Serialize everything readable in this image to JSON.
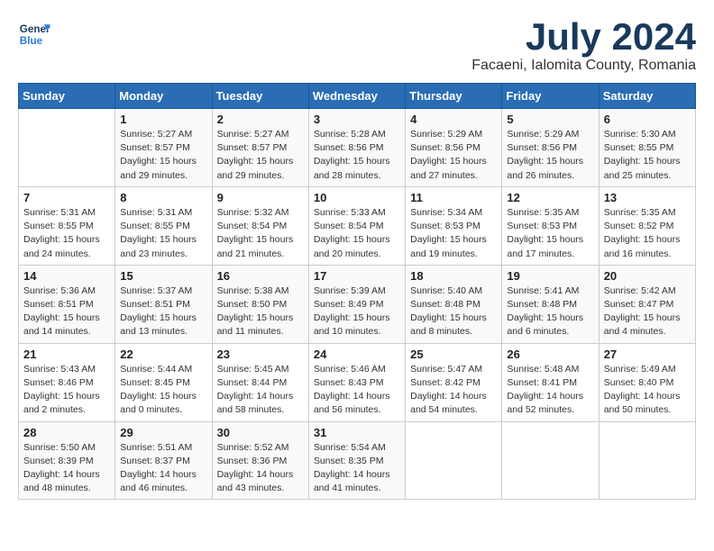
{
  "logo": {
    "line1": "General",
    "line2": "Blue"
  },
  "title": "July 2024",
  "subtitle": "Facaeni, Ialomita County, Romania",
  "days_header": [
    "Sunday",
    "Monday",
    "Tuesday",
    "Wednesday",
    "Thursday",
    "Friday",
    "Saturday"
  ],
  "weeks": [
    [
      {
        "num": "",
        "info": ""
      },
      {
        "num": "1",
        "info": "Sunrise: 5:27 AM\nSunset: 8:57 PM\nDaylight: 15 hours\nand 29 minutes."
      },
      {
        "num": "2",
        "info": "Sunrise: 5:27 AM\nSunset: 8:57 PM\nDaylight: 15 hours\nand 29 minutes."
      },
      {
        "num": "3",
        "info": "Sunrise: 5:28 AM\nSunset: 8:56 PM\nDaylight: 15 hours\nand 28 minutes."
      },
      {
        "num": "4",
        "info": "Sunrise: 5:29 AM\nSunset: 8:56 PM\nDaylight: 15 hours\nand 27 minutes."
      },
      {
        "num": "5",
        "info": "Sunrise: 5:29 AM\nSunset: 8:56 PM\nDaylight: 15 hours\nand 26 minutes."
      },
      {
        "num": "6",
        "info": "Sunrise: 5:30 AM\nSunset: 8:55 PM\nDaylight: 15 hours\nand 25 minutes."
      }
    ],
    [
      {
        "num": "7",
        "info": "Sunrise: 5:31 AM\nSunset: 8:55 PM\nDaylight: 15 hours\nand 24 minutes."
      },
      {
        "num": "8",
        "info": "Sunrise: 5:31 AM\nSunset: 8:55 PM\nDaylight: 15 hours\nand 23 minutes."
      },
      {
        "num": "9",
        "info": "Sunrise: 5:32 AM\nSunset: 8:54 PM\nDaylight: 15 hours\nand 21 minutes."
      },
      {
        "num": "10",
        "info": "Sunrise: 5:33 AM\nSunset: 8:54 PM\nDaylight: 15 hours\nand 20 minutes."
      },
      {
        "num": "11",
        "info": "Sunrise: 5:34 AM\nSunset: 8:53 PM\nDaylight: 15 hours\nand 19 minutes."
      },
      {
        "num": "12",
        "info": "Sunrise: 5:35 AM\nSunset: 8:53 PM\nDaylight: 15 hours\nand 17 minutes."
      },
      {
        "num": "13",
        "info": "Sunrise: 5:35 AM\nSunset: 8:52 PM\nDaylight: 15 hours\nand 16 minutes."
      }
    ],
    [
      {
        "num": "14",
        "info": "Sunrise: 5:36 AM\nSunset: 8:51 PM\nDaylight: 15 hours\nand 14 minutes."
      },
      {
        "num": "15",
        "info": "Sunrise: 5:37 AM\nSunset: 8:51 PM\nDaylight: 15 hours\nand 13 minutes."
      },
      {
        "num": "16",
        "info": "Sunrise: 5:38 AM\nSunset: 8:50 PM\nDaylight: 15 hours\nand 11 minutes."
      },
      {
        "num": "17",
        "info": "Sunrise: 5:39 AM\nSunset: 8:49 PM\nDaylight: 15 hours\nand 10 minutes."
      },
      {
        "num": "18",
        "info": "Sunrise: 5:40 AM\nSunset: 8:48 PM\nDaylight: 15 hours\nand 8 minutes."
      },
      {
        "num": "19",
        "info": "Sunrise: 5:41 AM\nSunset: 8:48 PM\nDaylight: 15 hours\nand 6 minutes."
      },
      {
        "num": "20",
        "info": "Sunrise: 5:42 AM\nSunset: 8:47 PM\nDaylight: 15 hours\nand 4 minutes."
      }
    ],
    [
      {
        "num": "21",
        "info": "Sunrise: 5:43 AM\nSunset: 8:46 PM\nDaylight: 15 hours\nand 2 minutes."
      },
      {
        "num": "22",
        "info": "Sunrise: 5:44 AM\nSunset: 8:45 PM\nDaylight: 15 hours\nand 0 minutes."
      },
      {
        "num": "23",
        "info": "Sunrise: 5:45 AM\nSunset: 8:44 PM\nDaylight: 14 hours\nand 58 minutes."
      },
      {
        "num": "24",
        "info": "Sunrise: 5:46 AM\nSunset: 8:43 PM\nDaylight: 14 hours\nand 56 minutes."
      },
      {
        "num": "25",
        "info": "Sunrise: 5:47 AM\nSunset: 8:42 PM\nDaylight: 14 hours\nand 54 minutes."
      },
      {
        "num": "26",
        "info": "Sunrise: 5:48 AM\nSunset: 8:41 PM\nDaylight: 14 hours\nand 52 minutes."
      },
      {
        "num": "27",
        "info": "Sunrise: 5:49 AM\nSunset: 8:40 PM\nDaylight: 14 hours\nand 50 minutes."
      }
    ],
    [
      {
        "num": "28",
        "info": "Sunrise: 5:50 AM\nSunset: 8:39 PM\nDaylight: 14 hours\nand 48 minutes."
      },
      {
        "num": "29",
        "info": "Sunrise: 5:51 AM\nSunset: 8:37 PM\nDaylight: 14 hours\nand 46 minutes."
      },
      {
        "num": "30",
        "info": "Sunrise: 5:52 AM\nSunset: 8:36 PM\nDaylight: 14 hours\nand 43 minutes."
      },
      {
        "num": "31",
        "info": "Sunrise: 5:54 AM\nSunset: 8:35 PM\nDaylight: 14 hours\nand 41 minutes."
      },
      {
        "num": "",
        "info": ""
      },
      {
        "num": "",
        "info": ""
      },
      {
        "num": "",
        "info": ""
      }
    ]
  ]
}
